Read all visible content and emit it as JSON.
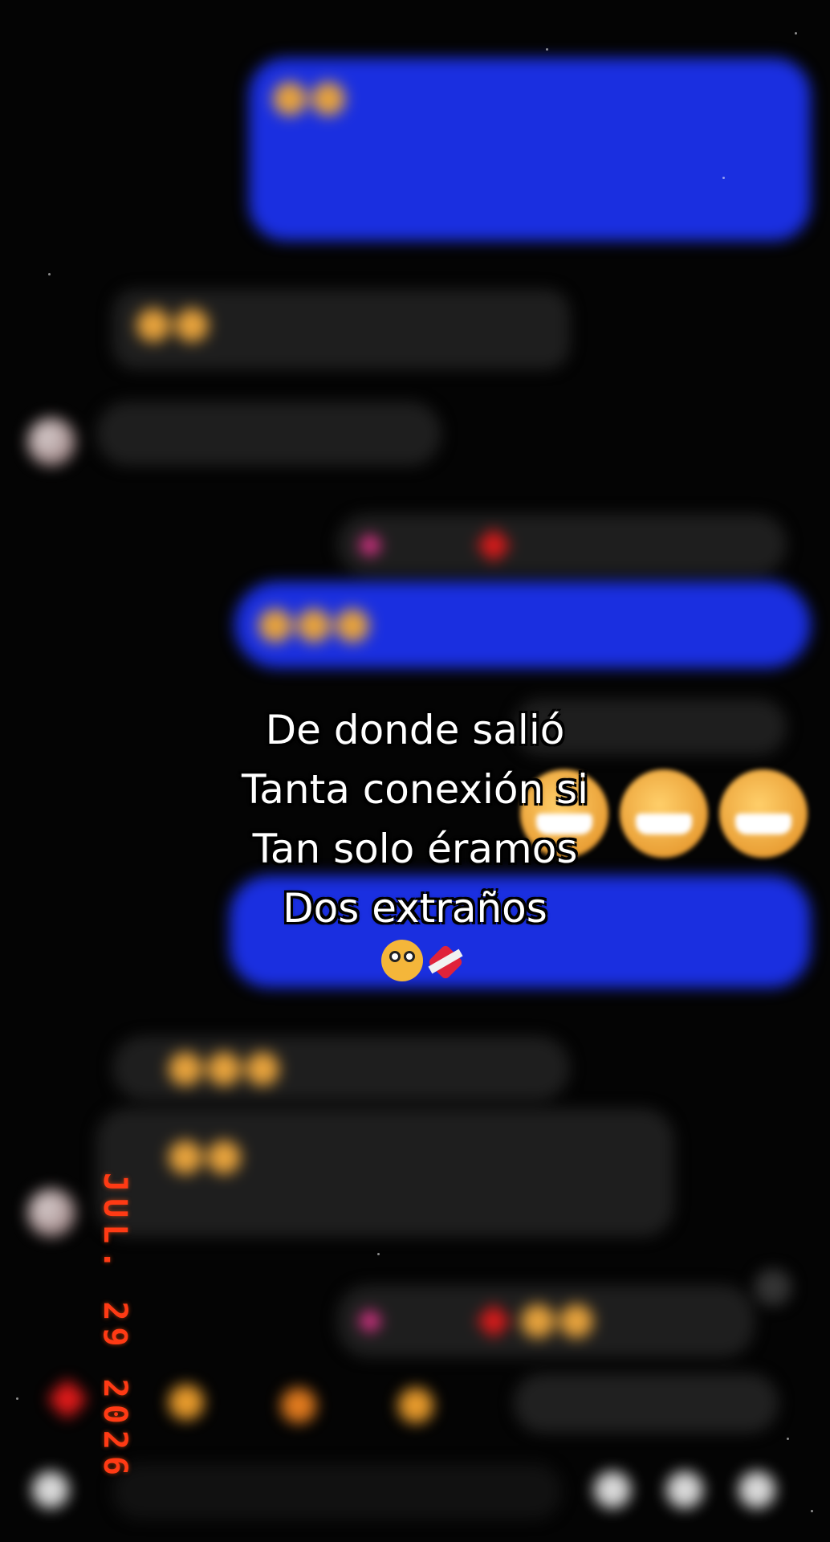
{
  "caption": {
    "line1": "De donde salió",
    "line2": "Tanta conexión si",
    "line3": "Tan solo éramos",
    "line4": "Dos extraños",
    "emoji_icons": [
      "flushed-face-icon",
      "mending-heart-icon"
    ]
  },
  "date_stamp": "JUL. 29 2026",
  "colors": {
    "sent_bubble": "#1a2fe0",
    "received_bubble": "#1e1e1e",
    "date_stamp": "#ff3a14",
    "caption_text": "#ffffff",
    "background": "#040404"
  },
  "chat": {
    "blurred": true,
    "reaction_bar_icons": [
      "heart-icon",
      "crying-laughing-icon",
      "fire-icon",
      "clapping-icon",
      "reply-icon"
    ],
    "composer_icons": [
      "camera-icon",
      "microphone-icon",
      "gallery-icon",
      "sticker-icon"
    ]
  }
}
